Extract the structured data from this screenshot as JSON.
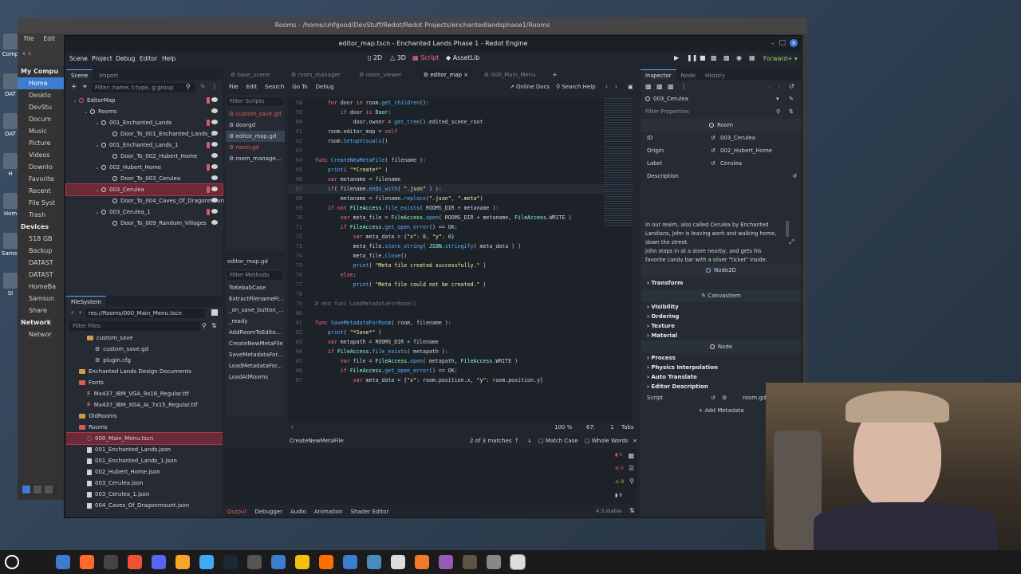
{
  "desktop": {
    "icons": [
      "Comp",
      "DAT",
      "DAT",
      "H",
      "Hom",
      "Samsu",
      "SI"
    ]
  },
  "file_manager": {
    "title": "Rooms - /home/uhfgood/DevStuff/Redot/Redot Projects/enchantedlandsphase1/Rooms",
    "menu": [
      "File",
      "Edit",
      "View",
      "Go",
      "Bookmarks",
      "Help"
    ],
    "sidebar": [
      {
        "label": "My Compu",
        "head": true
      },
      {
        "label": "Home",
        "selected": true
      },
      {
        "label": "Deskto"
      },
      {
        "label": "DevStu"
      },
      {
        "label": "Docum"
      },
      {
        "label": "Music"
      },
      {
        "label": "Picture"
      },
      {
        "label": "Videos"
      },
      {
        "label": "Downlo"
      },
      {
        "label": "Favorite"
      },
      {
        "label": "Recent"
      },
      {
        "label": "File Syst"
      },
      {
        "label": "Trash"
      },
      {
        "label": "Devices",
        "head": true
      },
      {
        "label": "518 GB"
      },
      {
        "label": "Backup"
      },
      {
        "label": "DATAST"
      },
      {
        "label": "DATAST"
      },
      {
        "label": "HomeBa"
      },
      {
        "label": "Samsun"
      },
      {
        "label": "Share"
      },
      {
        "label": "Network",
        "head": true
      },
      {
        "label": "Networ"
      }
    ]
  },
  "editor": {
    "title": "editor_map.tscn - Enchanted Lands Phase 1 - Redot Engine",
    "menu": [
      "Scene",
      "Project",
      "Debug",
      "Editor",
      "Help"
    ],
    "workspaces": [
      "2D",
      "3D",
      "Script",
      "AssetLib"
    ],
    "renderer": "Forward+",
    "scene_dock": {
      "tabs": [
        "Scene",
        "Import"
      ],
      "filter_placeholder": "Filter: name, t:type, g:group",
      "tree": [
        {
          "label": "EditorMap",
          "depth": 0,
          "script": true
        },
        {
          "label": "Rooms",
          "depth": 1
        },
        {
          "label": "001_Enchanted_Lands",
          "depth": 2,
          "script": true
        },
        {
          "label": "Door_To_001_Enchanted_Lands_1",
          "depth": 3
        },
        {
          "label": "001_Enchanted_Lands_1",
          "depth": 2,
          "script": true
        },
        {
          "label": "Door_To_002_Hubert_Home",
          "depth": 3
        },
        {
          "label": "002_Hubert_Home",
          "depth": 2,
          "script": true
        },
        {
          "label": "Door_To_003_Cerulea",
          "depth": 3
        },
        {
          "label": "003_Cerulea",
          "depth": 2,
          "script": true,
          "selected": true
        },
        {
          "label": "Door_To_004_Caves_Of_Dragonmount",
          "depth": 3
        },
        {
          "label": "003_Cerulea_1",
          "depth": 2,
          "script": true
        },
        {
          "label": "Door_To_009_Random_Villages",
          "depth": 3
        }
      ]
    },
    "filesystem": {
      "title": "FileSystem",
      "path": "res://Rooms/000_Main_Menu.tscn",
      "filter_placeholder": "Filter Files",
      "items": [
        {
          "label": "custom_save",
          "depth": 2,
          "type": "folder"
        },
        {
          "label": "custom_save.gd",
          "depth": 3,
          "type": "gear"
        },
        {
          "label": "plugin.cfg",
          "depth": 3,
          "type": "gear"
        },
        {
          "label": "Enchanted Lands Design Documents",
          "depth": 1,
          "type": "folder"
        },
        {
          "label": "Fonts",
          "depth": 1,
          "type": "folder-red"
        },
        {
          "label": "Mx437_IBM_VGA_9x16_Regular.ttf",
          "depth": 2,
          "type": "font"
        },
        {
          "label": "Mx437_IBM_XGA_AI_7x15_Regular.ttf",
          "depth": 2,
          "type": "font"
        },
        {
          "label": "OldRooms",
          "depth": 1,
          "type": "folder"
        },
        {
          "label": "Rooms",
          "depth": 1,
          "type": "folder-red"
        },
        {
          "label": "000_Main_Menu.tscn",
          "depth": 2,
          "type": "scene",
          "selected": true
        },
        {
          "label": "001_Enchanted_Lands.json",
          "depth": 2,
          "type": "file"
        },
        {
          "label": "001_Enchanted_Lands_1.json",
          "depth": 2,
          "type": "file"
        },
        {
          "label": "002_Hubert_Home.json",
          "depth": 2,
          "type": "file"
        },
        {
          "label": "003_Cerulea.json",
          "depth": 2,
          "type": "file"
        },
        {
          "label": "003_Cerulea_1.json",
          "depth": 2,
          "type": "file"
        },
        {
          "label": "004_Caves_Of_Dragonmount.json",
          "depth": 2,
          "type": "file"
        },
        {
          "label": "005_Sky.json",
          "depth": 2,
          "type": "file"
        }
      ]
    },
    "script_tabs": [
      "base_scene",
      "room_manager",
      "room_viewer",
      "editor_map",
      "000_Main_Menu"
    ],
    "script_menu": [
      "File",
      "Edit",
      "Search",
      "Go To",
      "Debug"
    ],
    "online_docs": "Online Docs",
    "search_help": "Search Help",
    "filter_scripts": "Filter Scripts",
    "scripts": [
      {
        "label": "custom_save.gd",
        "color": "#e05b5b"
      },
      {
        "label": "doorgd",
        "color": "#cdd3dc"
      },
      {
        "label": "editor_map.gd",
        "color": "#cdd3dc",
        "selected": true
      },
      {
        "label": "room.gd",
        "color": "#e05b5b"
      },
      {
        "label": "room_manage...",
        "color": "#cdd3dc"
      }
    ],
    "current_script": "editor_map.gd",
    "filter_methods": "Filter Methods",
    "methods": [
      "ToKebabCase",
      "ExtractFilenameFr...",
      "_on_save_button_...",
      "_ready",
      "AddRoomToEdito...",
      "CreateNewMetaFile",
      "SaveMetadataFor...",
      "LoadMetadataFor...",
      "LoadAllRooms"
    ],
    "code": [
      {
        "n": "58",
        "html": "    <span class='kw'>for</span> door <span class='kw'>in</span> room.<span class='fn'>get_children</span>():"
      },
      {
        "n": "59",
        "html": "        <span class='kw'>if</span> door <span class='kw'>is</span> <span class='ty'>Door</span>:"
      },
      {
        "n": "60",
        "html": "            door.owner = <span class='fn'>get_tree</span>().edited_scene_root"
      },
      {
        "n": "61",
        "html": "    room.editor_map = <span class='kw'>self</span>"
      },
      {
        "n": "62",
        "html": "    room.<span class='fn'>SetupVisuals</span>()"
      },
      {
        "n": "63",
        "html": ""
      },
      {
        "n": "64",
        "html": "<span class='kw'>func</span> <span class='fn'>CreateNewMetaFile</span>( filename ):"
      },
      {
        "n": "65",
        "html": "    <span class='fn'>print</span>( <span class='st'>\"*Create*\"</span> )"
      },
      {
        "n": "66",
        "html": "    <span class='kw'>var</span> metaname = filename"
      },
      {
        "n": "67",
        "html": "    <span class='kw'>if</span>( filename.<span class='fn'>ends_with</span>( <span class='st'>\".json\"</span> ) ):"
      },
      {
        "n": "68",
        "html": "        metaname = filename.<span class='fn'>replace</span>(<span class='st'>\".json\"</span>, <span class='st'>\".meta\"</span>)"
      },
      {
        "n": "69",
        "html": "    <span class='kw'>if not</span> <span class='ty'>FileAccess</span>.<span class='fn'>file_exists</span>( ROOMS_DIR + metaname ):"
      },
      {
        "n": "70",
        "html": "        <span class='kw'>var</span> meta_file = <span class='ty'>FileAccess</span>.<span class='fn'>open</span>( ROOMS_DIR + metaname, <span class='ty'>FileAccess</span>.WRITE )"
      },
      {
        "n": "71",
        "html": "        <span class='kw'>if</span> <span class='ty'>FileAccess</span>.<span class='fn'>get_open_error</span>() == OK:"
      },
      {
        "n": "72",
        "html": "            <span class='kw'>var</span> meta_data = {<span class='st'>\"x\"</span>: <span class='nm'>0</span>, <span class='st'>\"y\"</span>: <span class='nm'>0</span>}"
      },
      {
        "n": "73",
        "html": "            meta_file.<span class='fn'>store_string</span>( <span class='ty'>JSON</span>.<span class='fn'>stringify</span>( meta_data ) )"
      },
      {
        "n": "74",
        "html": "            meta_file.<span class='fn'>close</span>()"
      },
      {
        "n": "75",
        "html": "            <span class='fn'>print</span>( <span class='st'>\"Meta file created successfully.\"</span> )"
      },
      {
        "n": "76",
        "html": "        <span class='kw'>else</span>:"
      },
      {
        "n": "77",
        "html": "            <span class='fn'>print</span>( <span class='st'>\"Meta file could not be created.\"</span> )"
      },
      {
        "n": "78",
        "html": ""
      },
      {
        "n": "79",
        "html": "<span class='cm'># end func LoadMetadataForRoom()</span>"
      },
      {
        "n": "80",
        "html": ""
      },
      {
        "n": "81",
        "html": "<span class='kw'>func</span> <span class='fn'>SaveMetadataForRoom</span>( room, filename ):"
      },
      {
        "n": "82",
        "html": "    <span class='fn'>print</span>( <span class='st'>\"*Save*\"</span> )"
      },
      {
        "n": "83",
        "html": "    <span class='kw'>var</span> metapath = ROOMS_DIR + filename"
      },
      {
        "n": "84",
        "html": "    <span class='kw'>if</span> <span class='ty'>FileAccess</span>.<span class='fn'>file_exists</span>( metapath ):"
      },
      {
        "n": "85",
        "html": "        <span class='kw'>var</span> file = <span class='ty'>FileAccess</span>.<span class='fn'>open</span>( metapath, <span class='ty'>FileAccess</span>.WRITE )"
      },
      {
        "n": "86",
        "html": "        <span class='kw'>if</span> <span class='ty'>FileAccess</span>.<span class='fn'>get_open_error</span>() == OK:"
      },
      {
        "n": "87",
        "html": "            <span class='kw'>var</span> meta_data = {<span class='st'>\"x\"</span>: room.position.x, <span class='st'>\"y\"</span>: room.position.y}"
      }
    ],
    "status": {
      "zoom": "100 %",
      "line": "67",
      "col": "1",
      "indent": "Tabs"
    },
    "find": {
      "query": "CreateNewMetaFile",
      "matches": "2 of 3 matches",
      "match_case": "Match Case",
      "whole_words": "Whole Words"
    },
    "bottom_tabs": [
      "Output",
      "Debugger",
      "Audio",
      "Animation",
      "Shader Editor"
    ],
    "version": "4.3.stable",
    "inspector": {
      "tabs": [
        "Inspector",
        "Node",
        "History"
      ],
      "node": "003_Cerulea",
      "filter": "Filter Properties",
      "class_room": "Room",
      "props": [
        {
          "key": "ID",
          "value": "003_Cerulea"
        },
        {
          "key": "Origin",
          "value": "002_Hubert_Home"
        },
        {
          "key": "Label",
          "value": "Cerulea"
        },
        {
          "key": "Description",
          "value": ""
        }
      ],
      "description": "In our realm, also called Cerulea by Enchanted Landians, John is leaving work and walking home, down the street.\nJohn stops in at a store nearby, and gets his favorite candy bar with a silver \"ticket\" inside.",
      "class_node2d": "Node2D",
      "transform": "Transform",
      "class_canvas": "CanvasItem",
      "canvas_sections": [
        "Visibility",
        "Ordering",
        "Texture",
        "Material"
      ],
      "class_node": "Node",
      "node_sections": [
        "Process",
        "Physics Interpolation",
        "Auto Translate",
        "Editor Description"
      ],
      "script_key": "Script",
      "script_value": "room.gd",
      "add_metadata": "Add Metadata"
    }
  },
  "taskbar": {
    "icons": [
      "menu-icon",
      "files-icon",
      "firefox-icon",
      "terminal-icon",
      "git-icon",
      "discord-icon",
      "x-icon",
      "shield-icon",
      "steam-icon",
      "toolbox-icon",
      "screen-icon",
      "chrome-icon",
      "play-icon",
      "mail-icon",
      "godot-icon",
      "notes-icon",
      "blender-icon",
      "app-icon",
      "gimp-icon",
      "clock-icon",
      "redot-icon"
    ]
  }
}
